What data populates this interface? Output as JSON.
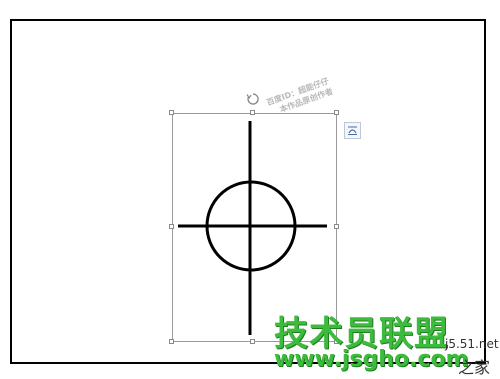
{
  "watermark": {
    "line1": "百度ID：超能仔仔",
    "line2": "本作品原创作者"
  },
  "brand": {
    "title": "技术员联盟",
    "site": "www.jsgho.com",
    "j51": "j5.51.net",
    "home": "之家"
  },
  "icons": {
    "rotate": "rotate-handle-icon",
    "layout": "layout-options-icon"
  },
  "colors": {
    "page_border": "#000000",
    "selection_border": "#9a9a9a",
    "brand_green": "#3dbb3d"
  }
}
